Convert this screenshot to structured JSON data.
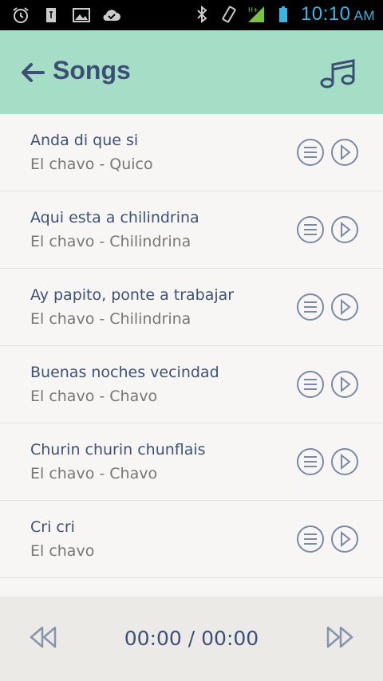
{
  "status_bar": {
    "time": "10:10",
    "ampm": "AM",
    "icons": [
      "alarm-icon",
      "usb-icon",
      "image-icon",
      "check-cloud-icon",
      "bluetooth-icon",
      "vibrate-icon",
      "signal-icon",
      "battery-icon"
    ],
    "network": "H+"
  },
  "app_bar": {
    "title": "Songs",
    "back_icon": "arrow-left-icon",
    "action_icon": "music-note-icon",
    "color": "#a6ddc6"
  },
  "songs": [
    {
      "title": "Anda di que si",
      "subtitle": "El chavo - Quico"
    },
    {
      "title": "Aqui esta a chilindrina",
      "subtitle": "El chavo - Chilindrina"
    },
    {
      "title": "Ay papito, ponte a trabajar",
      "subtitle": "El chavo - Chilindrina"
    },
    {
      "title": "Buenas noches vecindad",
      "subtitle": "El chavo - Chavo"
    },
    {
      "title": "Churin churin chunflais",
      "subtitle": "El chavo - Chavo"
    },
    {
      "title": "Cri cri",
      "subtitle": "El chavo"
    }
  ],
  "player": {
    "time": "00:00 / 00:00",
    "rewind_icon": "rewind-icon",
    "forward_icon": "fast-forward-icon"
  }
}
